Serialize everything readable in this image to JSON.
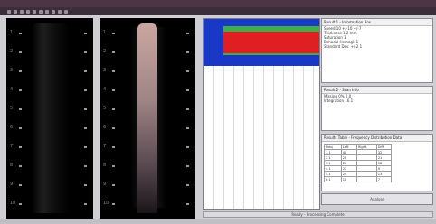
{
  "colors": {
    "titlebar": "#4e3545",
    "toolbar": "#3a2f38",
    "band_red": "#e01f23",
    "band_blue": "#1838c8",
    "band_green": "#3fae49"
  },
  "toolbar": {
    "icons": [
      "tool-icon-1",
      "tool-icon-2",
      "tool-icon-3",
      "tool-icon-4",
      "tool-icon-5",
      "tool-icon-6",
      "tool-icon-7",
      "tool-icon-8",
      "tool-icon-9",
      "tool-icon-10"
    ]
  },
  "depth_labels": [
    "1",
    "2",
    "3",
    "4",
    "5",
    "6",
    "7",
    "8",
    "9",
    "10"
  ],
  "panel_summary": {
    "title": "Result 1 - Information Box",
    "lines": [
      "Speed 10 +/-10 +/-7",
      "Thickness 1.2 mm",
      "Saturation 1",
      "Bimodal Hemogl. 1",
      "Standard Dev. +/-2.1"
    ]
  },
  "panel_second": {
    "title": "Result 2 - Scan Info",
    "lines": [
      "Missing 0% 0.0",
      "Integration 16.1"
    ]
  },
  "panel_table": {
    "title": "Results Table - Frequency Distribution Data",
    "header": [
      "Freq",
      "Left",
      "Right",
      "Diff"
    ],
    "rows": [
      [
        "1.1",
        "48",
        "",
        "32"
      ],
      [
        "2.1",
        "28",
        "",
        "21"
      ],
      [
        "3.1",
        "26",
        "",
        "18"
      ],
      [
        "4.1",
        "22",
        "",
        "9"
      ],
      [
        "5.1",
        "24",
        "",
        "13"
      ],
      [
        "6.1",
        "18",
        "",
        "7"
      ]
    ]
  },
  "action_button": {
    "label": "Analyse"
  },
  "status_bar": {
    "text": "Ready - Processing Complete"
  }
}
